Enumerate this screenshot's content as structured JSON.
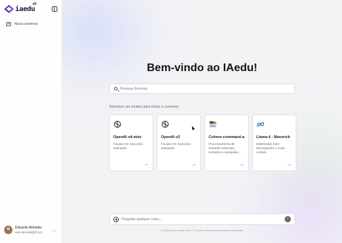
{
  "sidebar": {
    "logo_text": "iaedu",
    "logo_sup": "e3",
    "new_chat_label": "Nova conversa",
    "user": {
      "name": "Eduardo Almeida",
      "email": "edu.almeida@fct.pt",
      "more": "..."
    }
  },
  "main": {
    "title": "Bem-vindo ao IAedu!",
    "search_placeholder": "Procurar Persona",
    "select_label": "Selecione um modelo para iniciar a conversa:",
    "cards": [
      {
        "name": "OpenAI o4-mini",
        "description": "Focado em raciocínio avançado",
        "icon": "openai-icon"
      },
      {
        "name": "OpenAI o3",
        "description": "Focado em raciocínio avançado",
        "icon": "openai-icon"
      },
      {
        "name": "Cohere-command-a",
        "description": "Processamento de entradas extensas, extração e manipulaç...",
        "icon": "cohere-icon"
      },
      {
        "name": "Llama 4 - Maverick",
        "description": "Multimodal, bom desempenho e custo contido",
        "icon": "meta-icon"
      }
    ],
    "arrow": "→",
    "prompt_placeholder": "Pergunte qualquer coisa...",
    "send_glyph": "↑",
    "disclaimer": "O IAedu pode cometer erros. Por favor, verifique as informações importantes."
  },
  "colors": {
    "accent": "#3a3ab5",
    "logo_purple": "#6f3bd9"
  }
}
